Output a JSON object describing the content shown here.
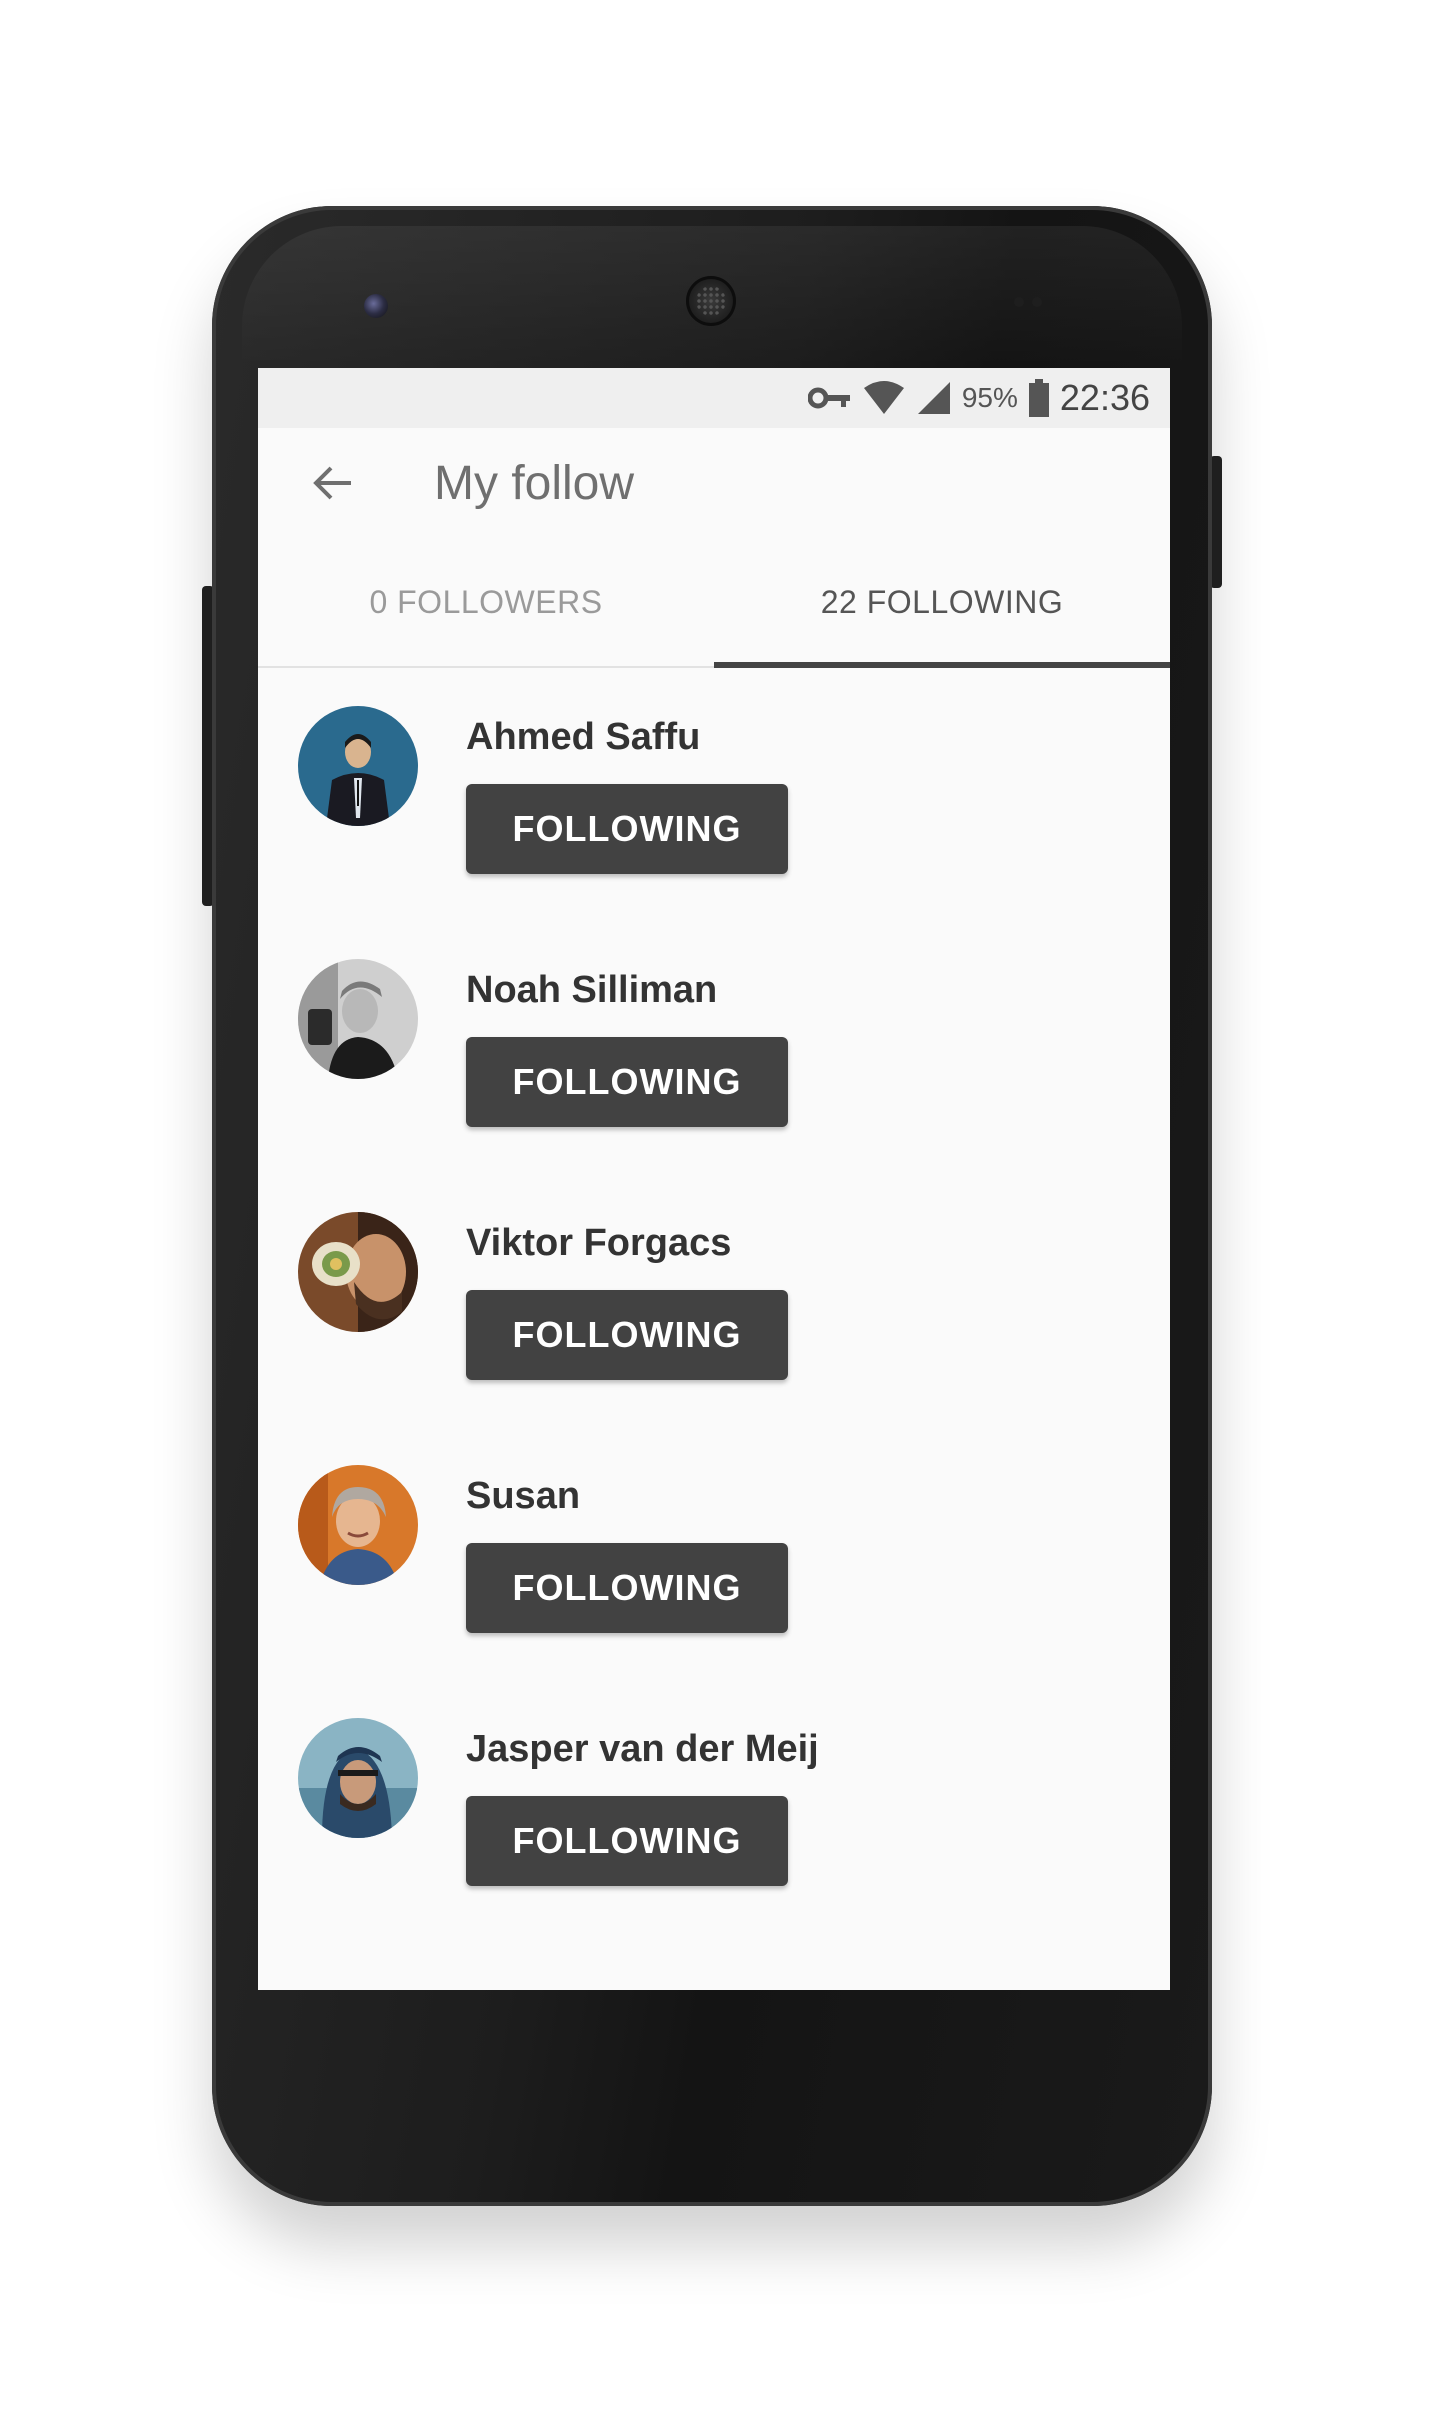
{
  "status_bar": {
    "battery_percent": "95%",
    "time": "22:36",
    "icons": [
      "vpn-key-icon",
      "wifi-icon",
      "signal-icon",
      "battery-icon"
    ]
  },
  "header": {
    "title": "My follow",
    "back_icon": "arrow-back-icon"
  },
  "tabs": [
    {
      "label": "0 FOLLOWERS",
      "active": false
    },
    {
      "label": "22 FOLLOWING",
      "active": true
    }
  ],
  "users": [
    {
      "name": "Ahmed Saffu",
      "button": "FOLLOWING"
    },
    {
      "name": "Noah Silliman",
      "button": "FOLLOWING"
    },
    {
      "name": "Viktor Forgacs",
      "button": "FOLLOWING"
    },
    {
      "name": "Susan",
      "button": "FOLLOWING"
    },
    {
      "name": "Jasper van der Meij",
      "button": "FOLLOWING"
    }
  ],
  "colors": {
    "button_bg": "#424242",
    "tab_indicator": "#444444",
    "screen_bg": "#fafafa"
  }
}
